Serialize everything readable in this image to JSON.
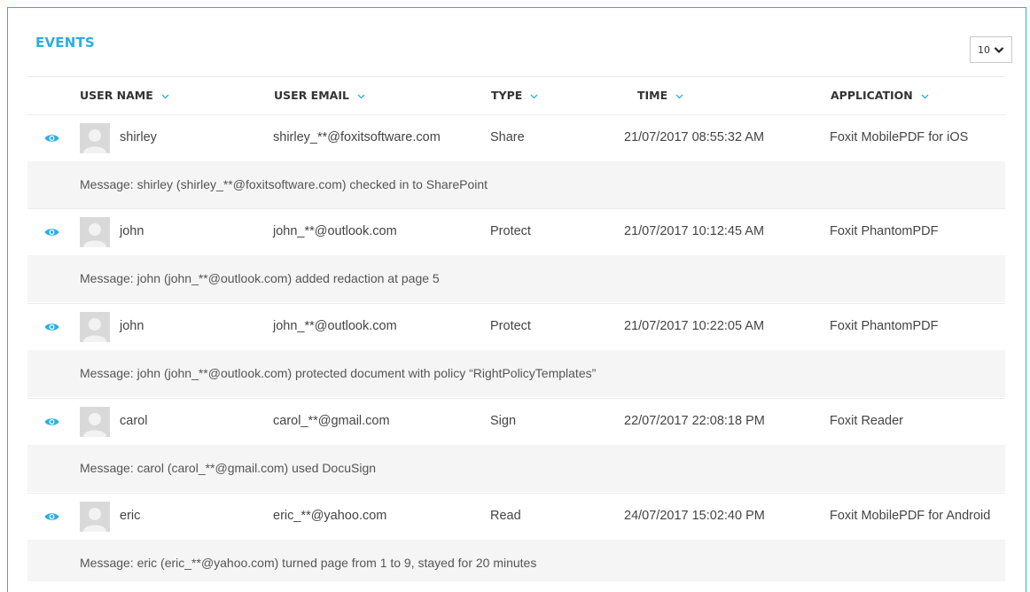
{
  "panel": {
    "title": "EVENTS",
    "page_size": "10"
  },
  "columns": [
    "USER NAME",
    "USER EMAIL",
    "TYPE",
    "TIME",
    "APPLICATION"
  ],
  "rows": [
    {
      "name": "shirley",
      "email": "shirley_**@foxitsoftware.com",
      "type": "Share",
      "time": "21/07/2017  08:55:32 AM",
      "app": "Foxit MobilePDF for iOS",
      "message": "Message: shirley (shirley_**@foxitsoftware.com) checked in to SharePoint"
    },
    {
      "name": "john",
      "email": "john_**@outlook.com",
      "type": "Protect",
      "time": "21/07/2017  10:12:45 AM",
      "app": "Foxit PhantomPDF",
      "message": "Message: john (john_**@outlook.com) added redaction at page 5"
    },
    {
      "name": "john",
      "email": "john_**@outlook.com",
      "type": "Protect",
      "time": "21/07/2017  10:22:05 AM",
      "app": "Foxit PhantomPDF",
      "message": "Message: john (john_**@outlook.com) protected document with policy “RightPolicyTemplates”"
    },
    {
      "name": "carol",
      "email": "carol_**@gmail.com",
      "type": "Sign",
      "time": "22/07/2017  22:08:18 PM",
      "app": "Foxit Reader",
      "message": "Message: carol (carol_**@gmail.com) used DocuSign"
    },
    {
      "name": "eric",
      "email": "eric_**@yahoo.com",
      "type": "Read",
      "time": "24/07/2017  15:02:40 PM",
      "app": "Foxit MobilePDF for Android",
      "message": "Message: eric (eric_**@yahoo.com) turned page from 1 to 9, stayed for 20 minutes"
    }
  ],
  "colors": {
    "accent": "#29aee3",
    "message_bg": "#f5f5f5"
  },
  "icons": {
    "view": "eye-icon",
    "sort": "chevron-down-icon",
    "avatar": "user-placeholder-icon"
  }
}
